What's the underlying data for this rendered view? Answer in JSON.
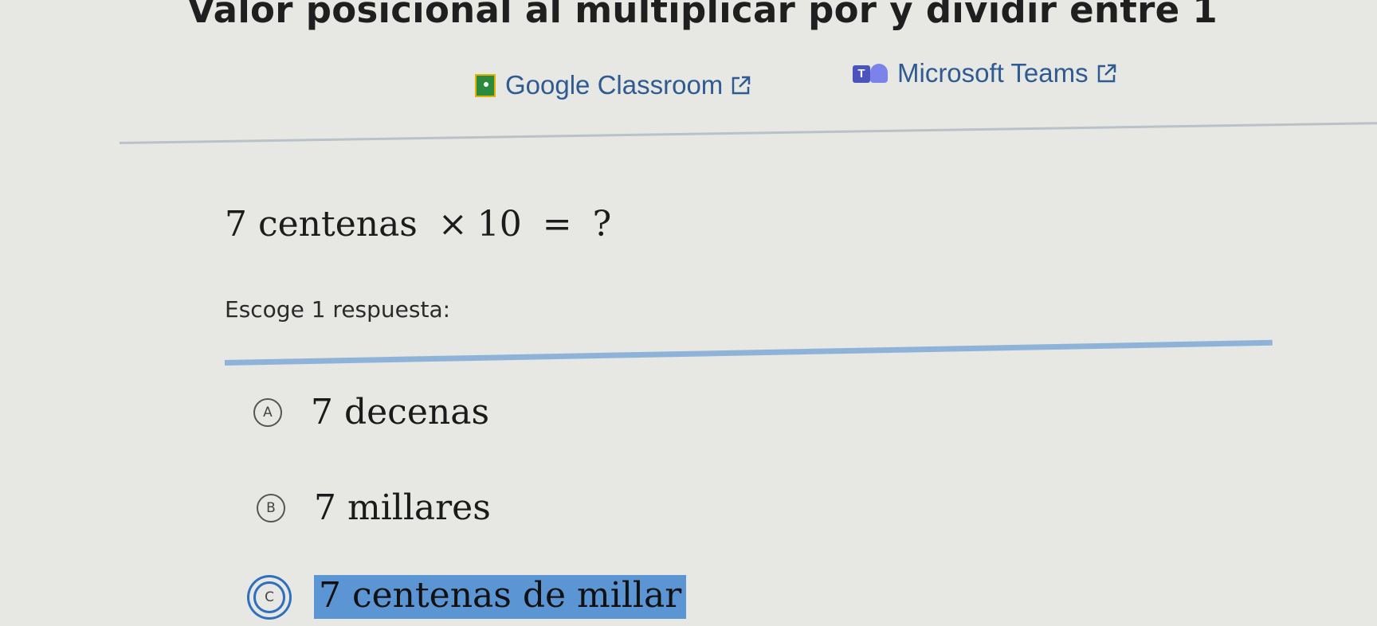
{
  "header": {
    "title": "Valor posicional al multiplicar por y dividir entre 1"
  },
  "share": {
    "classroom_label": "Google Classroom",
    "teams_label": "Microsoft Teams"
  },
  "question": {
    "number": "7",
    "unit": "centenas",
    "operator": "×",
    "multiplier": "10",
    "equals": "=",
    "unknown": "?"
  },
  "prompt": "Escoge 1 respuesta:",
  "choices": [
    {
      "letter": "A",
      "text": "7 decenas",
      "selected": false
    },
    {
      "letter": "B",
      "text": "7 millares",
      "selected": false
    },
    {
      "letter": "C",
      "text": "7 centenas de millar",
      "selected": true
    }
  ],
  "colors": {
    "link": "#2f5b91",
    "selection_highlight": "#5c95d4",
    "divider_blue": "#8fb3d8"
  }
}
